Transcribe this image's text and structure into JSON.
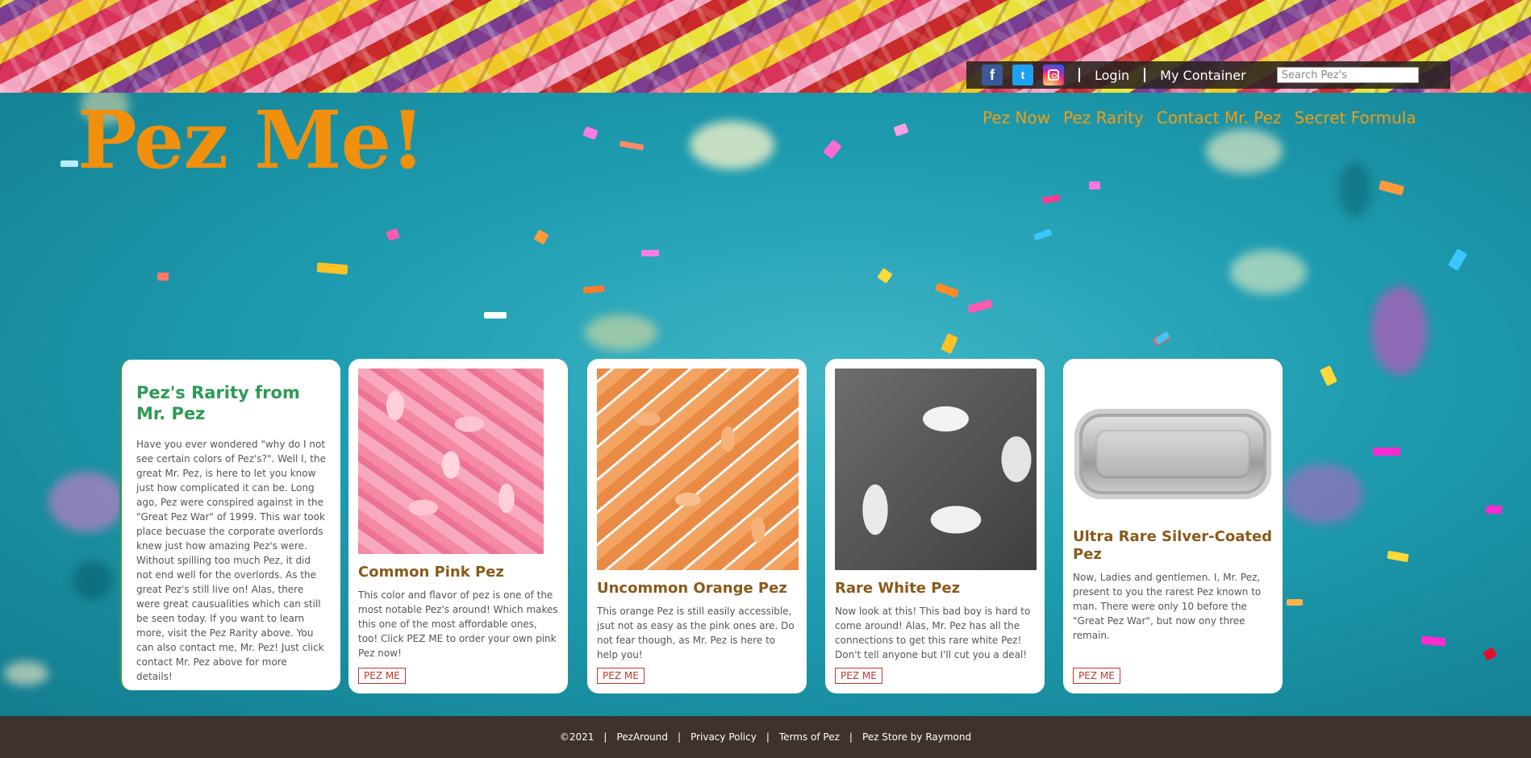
{
  "topbar": {
    "social": [
      {
        "icon": "facebook-icon",
        "glyph": "f"
      },
      {
        "icon": "twitter-icon",
        "glyph": "t"
      },
      {
        "icon": "instagram-icon",
        "glyph": ""
      }
    ],
    "login": "Login",
    "my_container": "My Container",
    "search_placeholder": "Search Pez's"
  },
  "site_title": "Pez Me!",
  "nav": [
    "Pez Now",
    "Pez Rarity",
    "Contact Mr. Pez",
    "Secret Formula"
  ],
  "intro": {
    "title": "Pez's Rarity from Mr. Pez",
    "body": "Have you ever wondered \"why do I not see certain colors of Pez's?\". Well I, the great Mr. Pez, is here to let you know just how complicated it can be. Long ago, Pez were conspired against in the \"Great Pez War\" of 1999. This war took place becuase the corporate overlords knew just how amazing Pez's were. Without spilling too much Pez, it did not end well for the overlords. As the great Pez's still live on! Alas, there were great causualities which can still be seen today. If you want to learn more, visit the Pez Rarity above. You can also contact me, Mr. Pez! Just click contact Mr. Pez above for more details!"
  },
  "products": [
    {
      "title": "Common Pink Pez",
      "desc": "This color and flavor of pez is one of the most notable Pez's around! Which makes this one of the most affordable ones, too! Click PEZ ME to order your own pink Pez now!",
      "button": "PEZ ME"
    },
    {
      "title": "Uncommon Orange Pez",
      "desc": "This orange Pez is still easily accessible, jsut not as easy as the pink ones are. Do not fear though, as Mr. Pez is here to help you!",
      "button": "PEZ ME"
    },
    {
      "title": "Rare White Pez",
      "desc": "Now look at this! This bad boy is hard to come around! Alas, Mr. Pez has all the connections to get this rare white Pez! Don't tell anyone but I'll cut you a deal!",
      "button": "PEZ ME"
    },
    {
      "title": "Ultra Rare Silver-Coated Pez",
      "desc": "Now, Ladies and gentlemen. I, Mr. Pez, present to you the rarest Pez known to man. There were only 10 before the \"Great Pez War\", but now ony three remain.",
      "button": "PEZ ME"
    }
  ],
  "footer": {
    "copyright": "©2021",
    "links": [
      "PezAround",
      "Privacy Policy",
      "Terms of Pez",
      "Pez Store by Raymond"
    ]
  },
  "colors": {
    "title_orange": "#f0900d",
    "nav_orange": "#f39c12",
    "intro_green": "#2e9a55",
    "product_title_brown": "#8a5a1a",
    "button_red": "#c0392b",
    "footer_bg": "#3d322d"
  }
}
